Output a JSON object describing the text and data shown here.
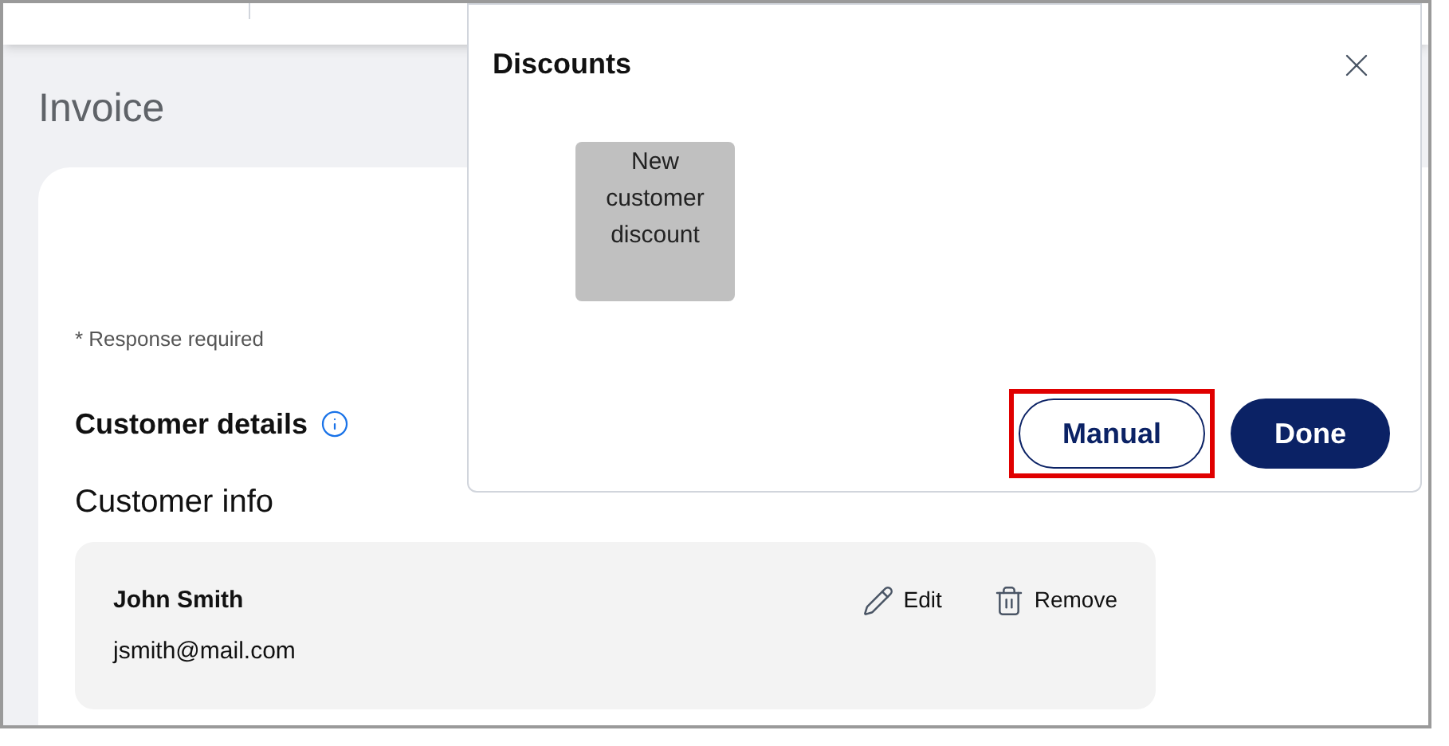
{
  "page": {
    "title": "Invoice"
  },
  "form": {
    "required_note": "* Response required",
    "section_title": "Customer details",
    "subsection_title": "Customer info",
    "customer": {
      "name": "John Smith",
      "email": "jsmith@mail.com",
      "actions": [
        {
          "kind": "edit",
          "label": "Edit"
        },
        {
          "kind": "remove",
          "label": "Remove"
        }
      ]
    }
  },
  "dialog": {
    "title": "Discounts",
    "discounts": [
      {
        "label": "New customer discount"
      }
    ],
    "buttons": [
      {
        "kind": "outline",
        "label": "Manual",
        "highlighted": true
      },
      {
        "kind": "primary",
        "label": "Done",
        "highlighted": false
      }
    ]
  }
}
